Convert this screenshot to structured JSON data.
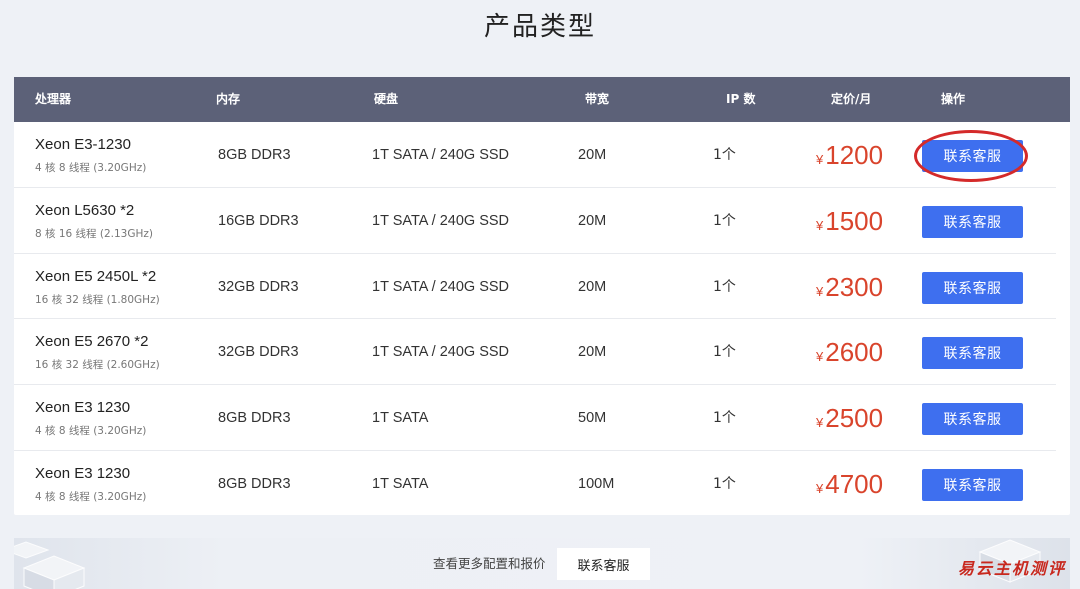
{
  "page": {
    "title": "产品类型"
  },
  "table": {
    "headers": [
      "处理器",
      "内存",
      "硬盘",
      "带宽",
      "IP 数",
      "定价/月",
      "操作"
    ],
    "currency_symbol": "¥",
    "rows": [
      {
        "cpu": "Xeon E3-1230",
        "cpu_detail": "4 核 8 线程 (3.20GHz)",
        "memory": "8GB DDR3",
        "disk": "1T SATA / 240G SSD",
        "bandwidth": "20M",
        "ip": "1个",
        "price": "1200",
        "action": "联系客服"
      },
      {
        "cpu": "Xeon L5630 *2",
        "cpu_detail": "8 核 16 线程 (2.13GHz)",
        "memory": "16GB DDR3",
        "disk": "1T SATA / 240G SSD",
        "bandwidth": "20M",
        "ip": "1个",
        "price": "1500",
        "action": "联系客服"
      },
      {
        "cpu": "Xeon E5 2450L *2",
        "cpu_detail": "16 核 32 线程 (1.80GHz)",
        "memory": "32GB DDR3",
        "disk": "1T SATA / 240G SSD",
        "bandwidth": "20M",
        "ip": "1个",
        "price": "2300",
        "action": "联系客服"
      },
      {
        "cpu": "Xeon E5 2670 *2",
        "cpu_detail": "16 核 32 线程 (2.60GHz)",
        "memory": "32GB DDR3",
        "disk": "1T SATA / 240G SSD",
        "bandwidth": "20M",
        "ip": "1个",
        "price": "2600",
        "action": "联系客服"
      },
      {
        "cpu": "Xeon E3 1230",
        "cpu_detail": "4 核 8 线程 (3.20GHz)",
        "memory": "8GB DDR3",
        "disk": "1T SATA",
        "bandwidth": "50M",
        "ip": "1个",
        "price": "2500",
        "action": "联系客服"
      },
      {
        "cpu": "Xeon E3 1230",
        "cpu_detail": "4 核 8 线程 (3.20GHz)",
        "memory": "8GB DDR3",
        "disk": "1T SATA",
        "bandwidth": "100M",
        "ip": "1个",
        "price": "4700",
        "action": "联系客服"
      }
    ]
  },
  "footer": {
    "text": "查看更多配置和报价",
    "button_label": "联系客服"
  },
  "watermark": "易云主机测评",
  "colors": {
    "header_bg": "#5c6178",
    "button_bg": "#3e6fef",
    "price": "#d9442c",
    "highlight_ring": "#d42a2a"
  }
}
